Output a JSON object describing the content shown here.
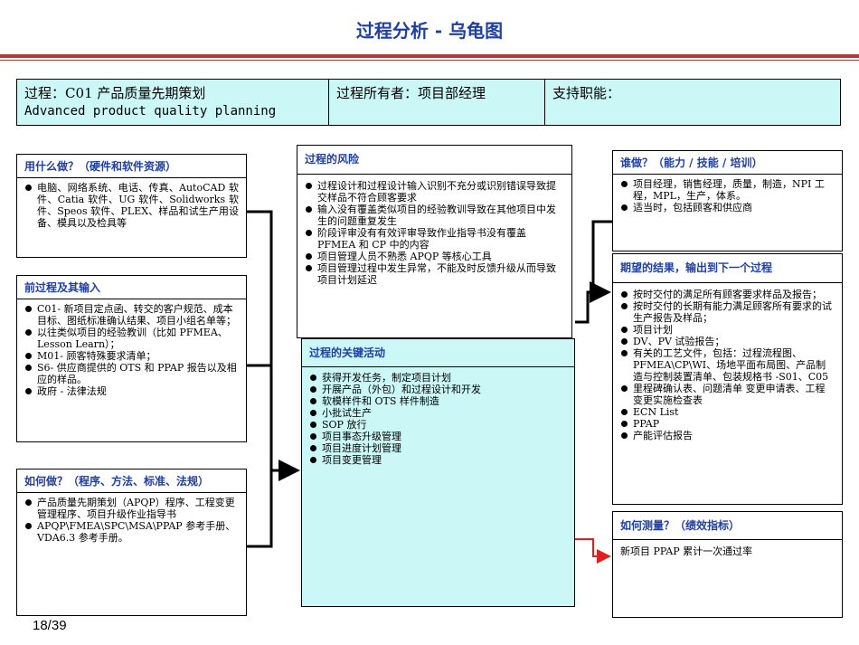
{
  "title": "过程分析 - 乌龟图",
  "header": {
    "process_label": "过程：C01 产品质量先期策划",
    "process_en": "Advanced product quality planning",
    "owner": "过程所有者：项目部经理",
    "support": "支持职能："
  },
  "what_with": {
    "heading": "用什么做？（硬件和软件资源）",
    "items": [
      "电脑、网络系统、电话、传真、AutoCAD 软件、Catia 软件、UG 软件、Solidworks 软件、Speos 软件、PLEX、样品和试生产用设备、模具以及检具等"
    ]
  },
  "inputs": {
    "heading": "前过程及其输入",
    "items": [
      "C01- 新项目定点函、转交的客户规范、成本目标、图纸标准确认结果、项目小组名单等；",
      "以往类似项目的经验教训（比如 PFMEA、Lesson Learn）；",
      "M01- 顾客特殊要求清单；",
      "S6- 供应商提供的 OTS 和 PPAP 报告以及相应的样品。",
      "政府 - 法律法规"
    ]
  },
  "how": {
    "heading": "如何做？（程序、方法、标准、法规）",
    "items": [
      "产品质量先期策划（APQP）程序、工程变更管理程序、项目升级作业指导书",
      "APQP\\FMEA\\SPC\\MSA\\PPAP 参考手册、VDA6.3 参考手册。"
    ]
  },
  "risks": {
    "heading": "过程的风险",
    "items": [
      "过程设计和过程设计输入识别不充分或识别错误导致提交样品不符合顾客要求",
      "输入没有覆盖类似项目的经验教训导致在其他项目中发生的问题重复发生",
      "阶段评审没有有效评审导致作业指导书没有覆盖 PFMEA 和 CP 中的内容",
      "项目管理人员不熟悉 APQP 等核心工具",
      "项目管理过程中发生异常，不能及时反馈升级从而导致项目计划延迟"
    ]
  },
  "activities": {
    "heading": "过程的关键活动",
    "items": [
      "获得开发任务，制定项目计划",
      "开展产品（外包）和过程设计和开发",
      "软模样件和 OTS 样件制造",
      "小批试生产",
      "SOP 放行",
      "项目事态升级管理",
      "项目进度计划管理",
      "项目变更管理"
    ]
  },
  "who": {
    "heading": "谁做？（能力 / 技能 / 培训）",
    "items": [
      "项目经理，销售经理，质量，制造，NPI 工程，MPL，生产，体系。",
      "适当时，包括顾客和供应商"
    ]
  },
  "outputs": {
    "heading": "期望的结果，输出到下一个过程",
    "items": [
      "按时交付的满足所有顾客要求样品及报告；",
      "按时交付的长期有能力满足顾客所有要求的试生产报告及样品；",
      "项目计划",
      "DV、PV 试验报告；",
      "有关的工艺文件，包括：过程流程图、PFMEA\\CP\\WI、场地平面布局图、产品制造与控制装置清单、包装规格书 -S01、C05",
      "里程碑确认表、问题清单 变更申请表、工程变更实施检查表",
      "ECN List",
      "PPAP",
      "产能评估报告"
    ]
  },
  "measure": {
    "heading": "如何测量？（绩效指标）",
    "text": "新项目 PPAP 累计一次通过率"
  },
  "page_number": "18/39",
  "colors": {
    "title": "#1f3fa3",
    "rule": "#b03a3a",
    "cyan": "#ccf7f7",
    "red_arrow": "#e02020"
  }
}
